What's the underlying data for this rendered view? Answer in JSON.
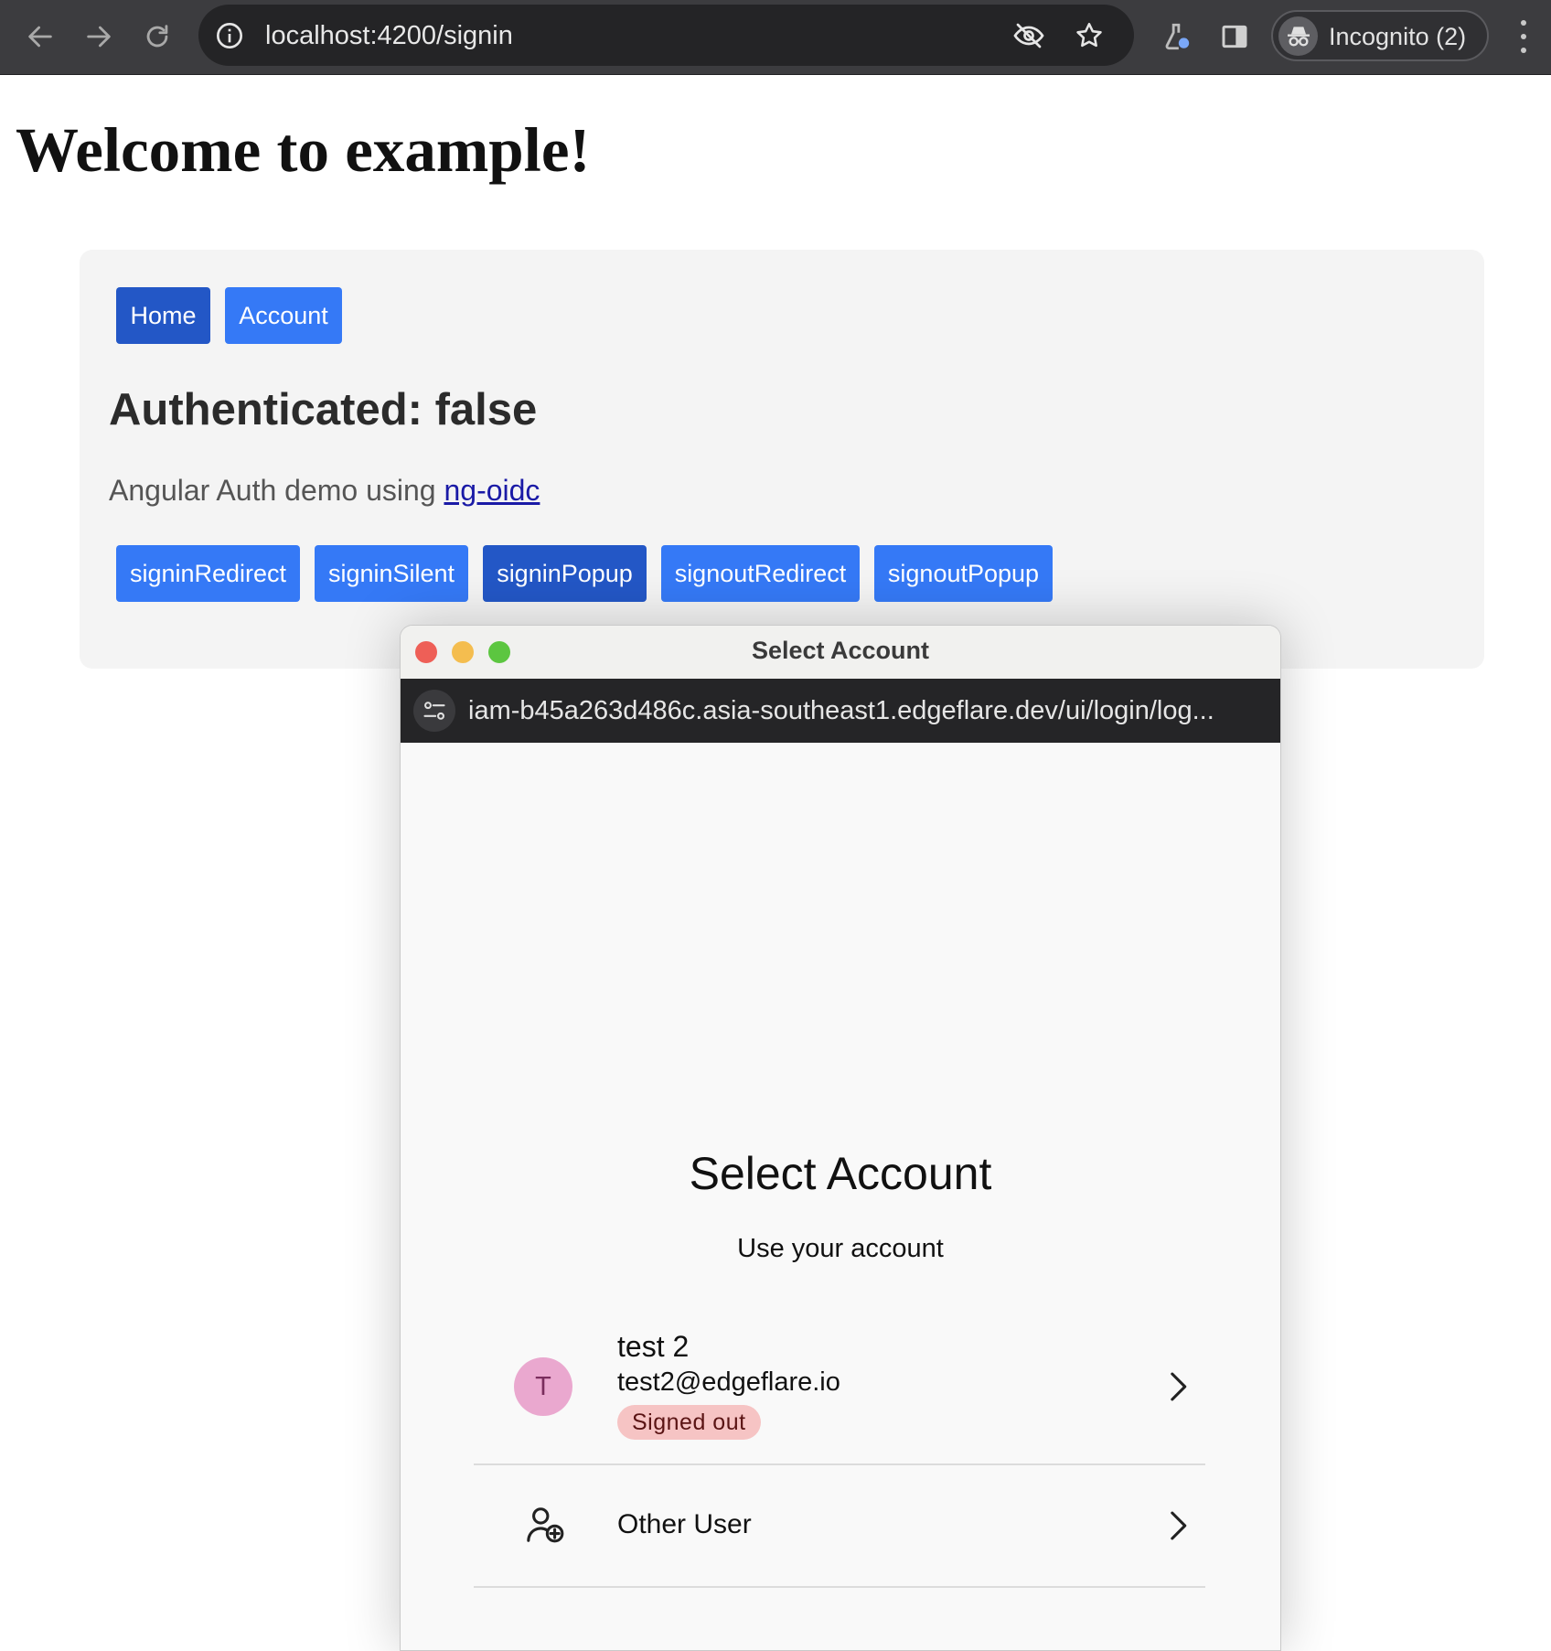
{
  "browser": {
    "url": "localhost:4200/signin",
    "profile_label": "Incognito (2)",
    "icons": [
      "back-arrow-icon",
      "forward-arrow-icon",
      "reload-icon",
      "site-info-icon",
      "eye-off-icon",
      "star-icon",
      "labs-flask-icon",
      "side-panel-icon",
      "incognito-icon",
      "more-vert-icon"
    ]
  },
  "page": {
    "title": "Welcome to example!",
    "nav": {
      "home_label": "Home",
      "account_label": "Account"
    },
    "auth_status": "Authenticated: false",
    "demo_prefix": "Angular Auth demo using",
    "demo_link": "ng-oidc",
    "actions": {
      "signin_redirect": "signinRedirect",
      "signin_silent": "signinSilent",
      "signin_popup": "signinPopup",
      "signout_redirect": "signoutRedirect",
      "signout_popup": "signoutPopup"
    }
  },
  "popup": {
    "window_title": "Select Account",
    "url": "iam-b45a263d486c.asia-southeast1.edgeflare.dev/ui/login/log...",
    "heading": "Select Account",
    "subheading": "Use your account",
    "account": {
      "initial": "T",
      "name": "test 2",
      "email": "test2@edgeflare.io",
      "status": "Signed out"
    },
    "other_user_label": "Other User"
  },
  "colors": {
    "primary_button": "#3579f6",
    "active_button": "#2357c6",
    "avatar_bg": "#eaa8cf",
    "badge_bg": "#f6c4c4",
    "traffic_red": "#ee5f57",
    "traffic_yellow": "#f4bd4f",
    "traffic_green": "#5cc640"
  }
}
